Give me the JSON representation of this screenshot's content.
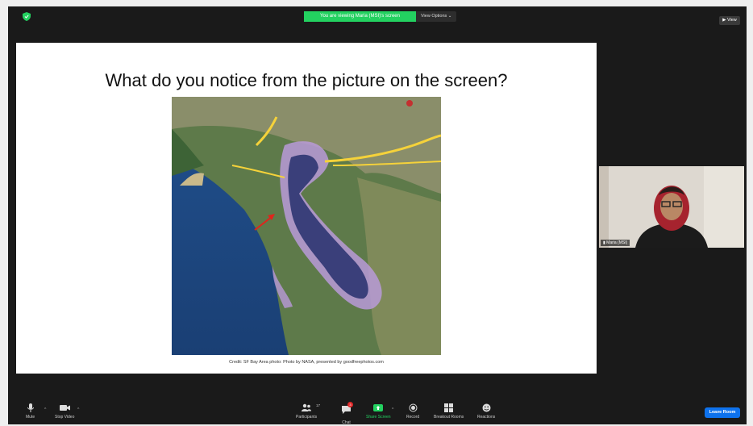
{
  "banner": {
    "viewing_text": "You are viewing Maria (MSI)'s screen",
    "options_label": "View Options ⌄"
  },
  "view_button": "▶ View",
  "slide": {
    "title": "What do you notice from the picture on the screen?",
    "credit": "Credit: SF Bay Area photo: Photo by NASA, presented by goodfreephotos.com"
  },
  "participant": {
    "name": "Maria (MSI)"
  },
  "toolbar": {
    "mute": "Mute",
    "stop_video": "Stop Video",
    "participants": "Participants",
    "participants_count": "17",
    "chat": "Chat",
    "chat_badge": "3",
    "share_screen": "Share Screen",
    "record": "Record",
    "breakout_rooms": "Breakout Rooms",
    "reactions": "Reactions",
    "leave": "Leave Room"
  },
  "colors": {
    "accent_green": "#23d160",
    "leave_blue": "#0e72ed",
    "badge_red": "#e02828"
  }
}
